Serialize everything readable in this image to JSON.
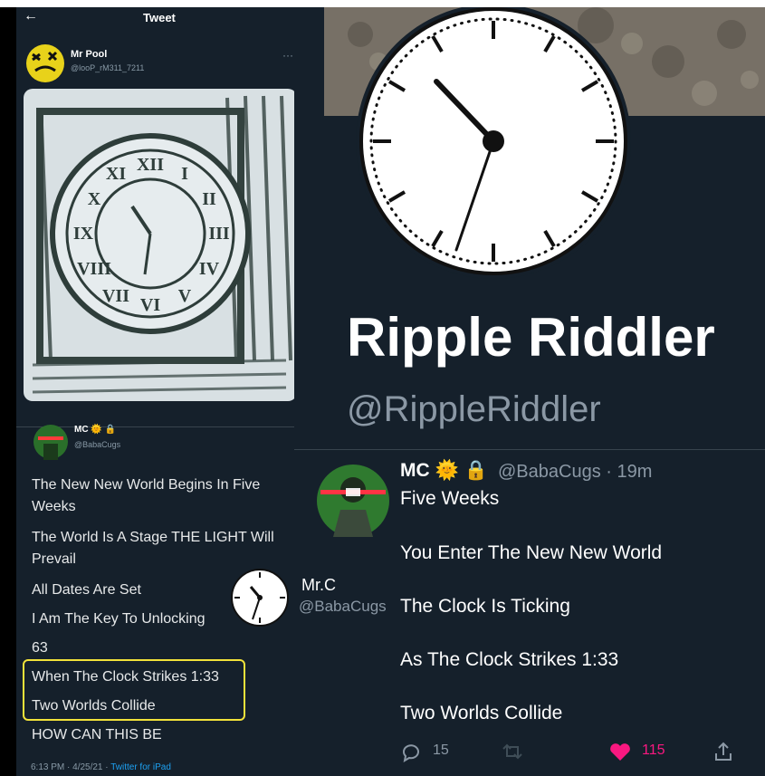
{
  "left_tweet": {
    "header_title": "Tweet",
    "author": {
      "name": "Mr Pool",
      "handle": "@looP_rM311_7211"
    },
    "thread_author": {
      "name": "MC",
      "handle": "@BabaCugs"
    },
    "lines": [
      "The New New World Begins In Five",
      "Weeks",
      "The World Is A Stage THE LIGHT Will",
      "Prevail",
      "All Dates Are Set",
      "I Am The Key To Unlocking",
      "63",
      "When The Clock Strikes 1:33",
      "Two Worlds Collide",
      "HOW CAN THIS BE"
    ],
    "timestamp": "6:13 PM · 4/25/21 · ",
    "source": "Twitter for iPad"
  },
  "profile": {
    "name": "Ripple Riddler",
    "handle": "@RippleRiddler"
  },
  "right_tweet": {
    "name": "MC",
    "handle": "@BabaCugs · 19m",
    "lines": [
      "Five Weeks",
      "You Enter The New New World",
      "The Clock Is Ticking",
      "As The Clock Strikes 1:33",
      "Two Worlds Collide"
    ],
    "replies": "15",
    "likes": "115"
  },
  "overlay": {
    "name": "Mr.C",
    "handle": "@BabaCugs"
  },
  "colors": {
    "background": "#15202b",
    "like": "#f91880",
    "highlight": "#f2e23a",
    "link": "#1da1f2"
  },
  "icons": [
    "back-arrow-icon",
    "more-icon",
    "reply-icon",
    "retweet-icon",
    "like-icon",
    "share-icon",
    "sun-emoji-icon",
    "lock-icon"
  ]
}
